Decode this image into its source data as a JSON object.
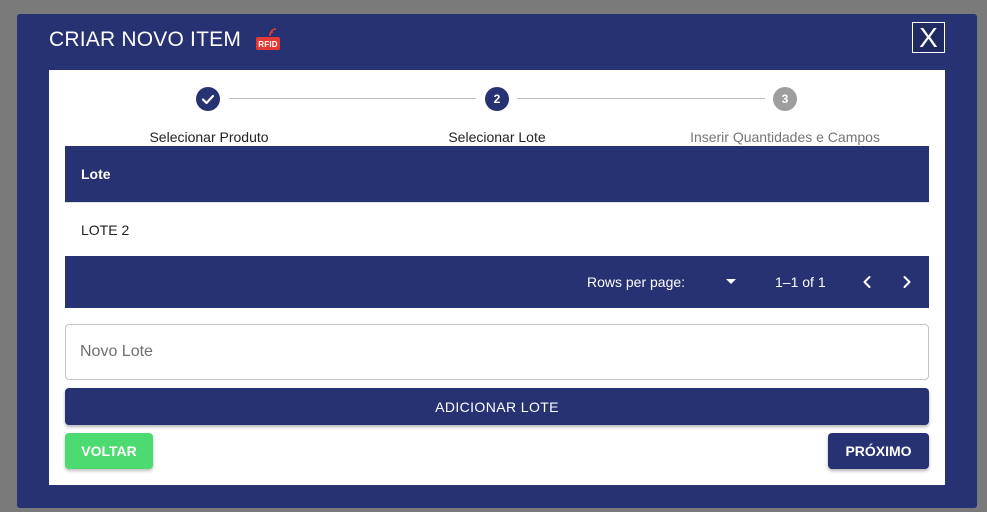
{
  "modal": {
    "title": "CRIAR NOVO ITEM",
    "rfid_icon_text": "RFID",
    "close_label": "X"
  },
  "stepper": {
    "steps": [
      {
        "number": "",
        "label": "Selecionar Produto",
        "state": "completed"
      },
      {
        "number": "2",
        "label": "Selecionar Lote",
        "state": "active"
      },
      {
        "number": "3",
        "label": "Inserir Quantidades e Campos",
        "state": "pending"
      }
    ]
  },
  "table": {
    "header": "Lote",
    "rows": [
      {
        "lote": "LOTE 2"
      }
    ],
    "pagination": {
      "rows_per_page_label": "Rows per page:",
      "range": "1–1 of 1"
    }
  },
  "form": {
    "novo_lote_placeholder": "Novo Lote",
    "novo_lote_value": "",
    "add_button": "ADICIONAR LOTE",
    "back_button": "VOLTAR",
    "next_button": "PRÓXIMO"
  },
  "colors": {
    "primary": "#263271",
    "success": "#4cdb71",
    "rfid_red": "#e53935",
    "overlay": "#7a7a7a"
  }
}
